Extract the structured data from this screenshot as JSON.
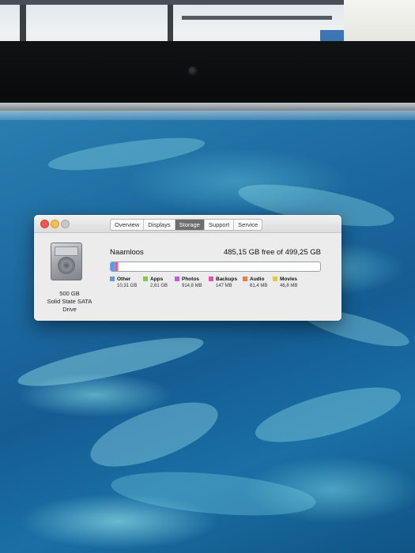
{
  "window": {
    "tabs": [
      {
        "label": "Overview"
      },
      {
        "label": "Displays"
      },
      {
        "label": "Storage",
        "active": true
      },
      {
        "label": "Support"
      },
      {
        "label": "Service"
      }
    ],
    "disk": {
      "capacity": "500 GB",
      "type_line1": "Solid State SATA",
      "type_line2": "Drive"
    },
    "volume": {
      "name": "Naamloos",
      "free_text": "485,15 GB free of 499,25 GB"
    },
    "categories": [
      {
        "name": "Other",
        "size": "10,31 GB",
        "color": "#5b9be0",
        "fraction": 0.0207
      },
      {
        "name": "Apps",
        "size": "2,61 GB",
        "color": "#7fcc52",
        "fraction": 0.0052
      },
      {
        "name": "Photos",
        "size": "914,8 MB",
        "color": "#c15ad6",
        "fraction": 0.0018
      },
      {
        "name": "Backups",
        "size": "147 MB",
        "color": "#e54fb4",
        "fraction": 0.0003
      },
      {
        "name": "Audio",
        "size": "61,4 MB",
        "color": "#ee7a4c",
        "fraction": 0.0001
      },
      {
        "name": "Movies",
        "size": "46,8 MB",
        "color": "#e8c544",
        "fraction": 0.0001
      }
    ]
  }
}
